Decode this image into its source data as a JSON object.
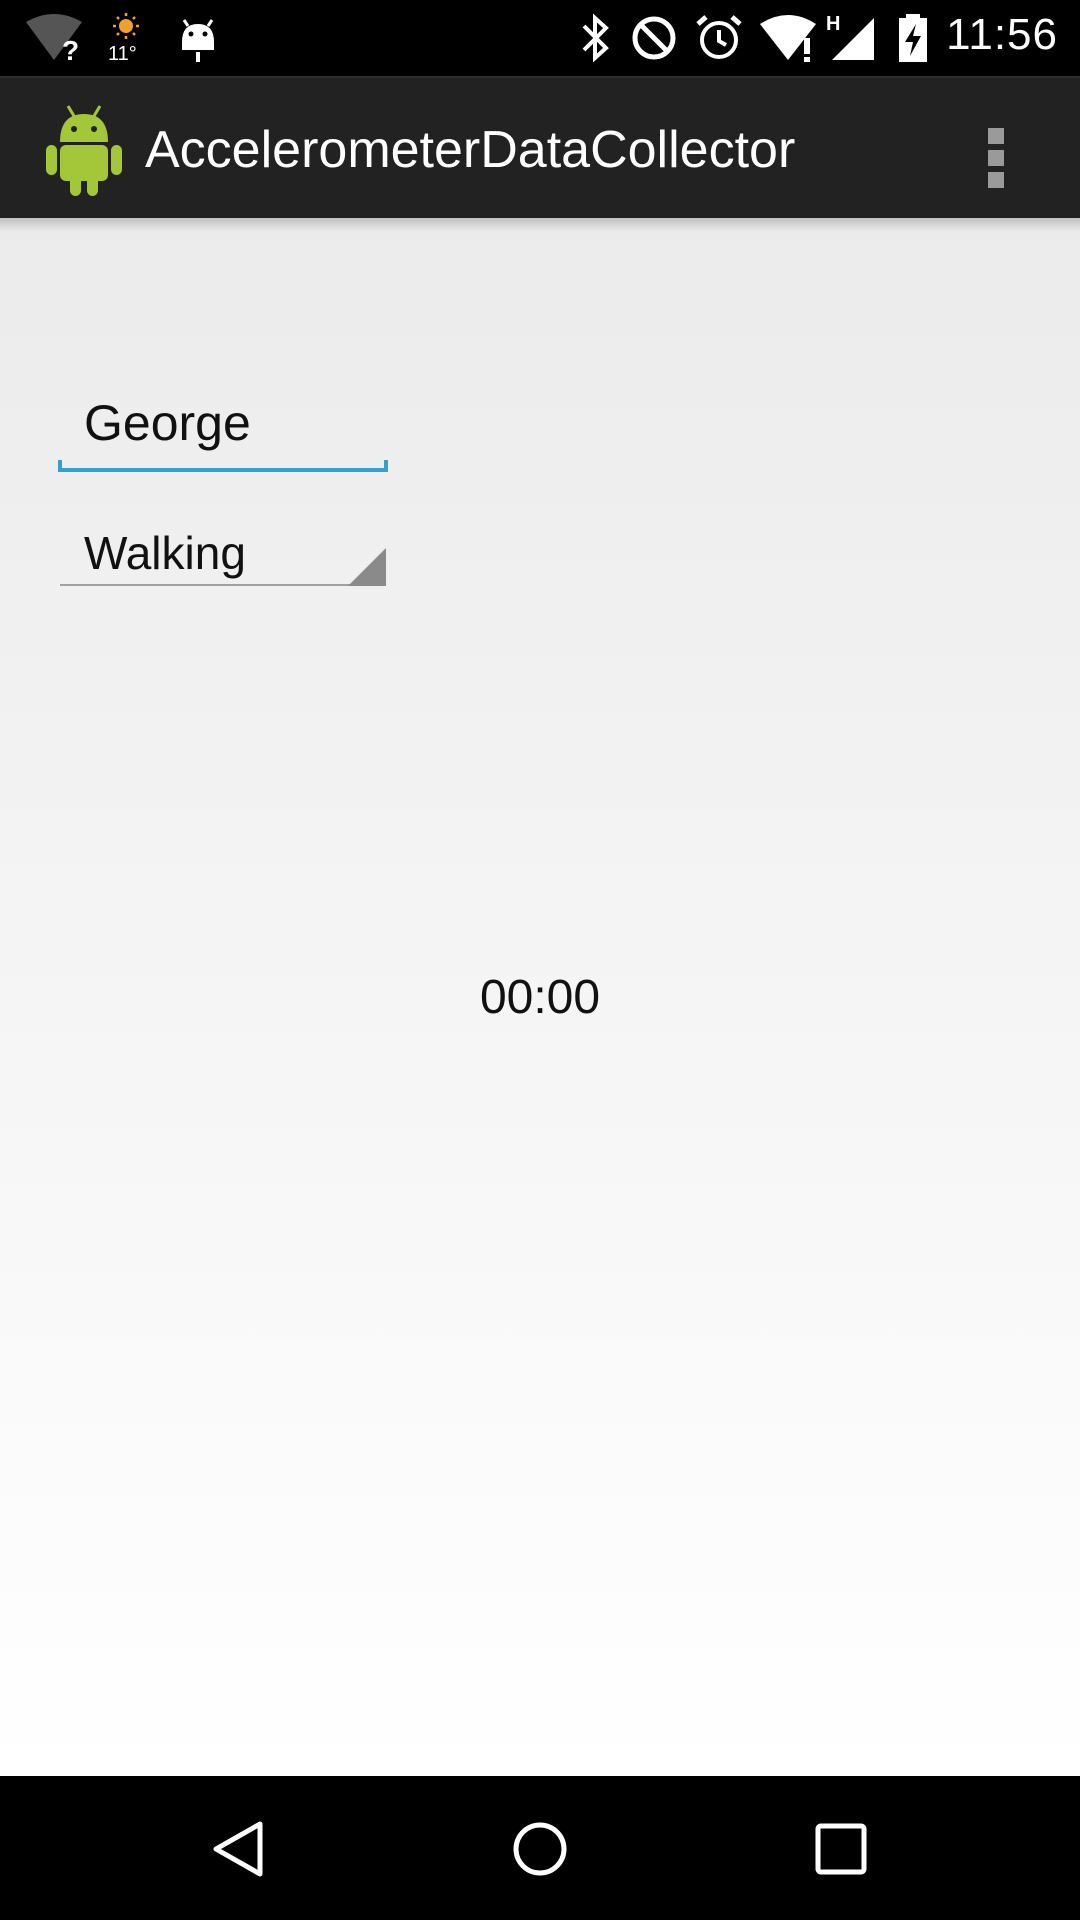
{
  "status_bar": {
    "time": "11:56",
    "temperature": "11°",
    "icons": [
      "wifi-unknown-icon",
      "weather-sun-icon",
      "android-debug-icon",
      "bluetooth-icon",
      "do-not-disturb-icon",
      "alarm-icon",
      "wifi-icon",
      "signal-h-icon",
      "battery-charging-icon"
    ]
  },
  "action_bar": {
    "title": "AccelerometerDataCollector",
    "icon": "android-app-icon",
    "overflow_icon": "overflow-menu-icon"
  },
  "form": {
    "name_value": "George",
    "activity_value": "Walking"
  },
  "timer": "00:00",
  "nav_bar": {
    "icons": [
      "back-icon",
      "home-icon",
      "recents-icon"
    ]
  },
  "colors": {
    "accent": "#33a0d0",
    "action_bar": "#222222",
    "android_green": "#a4c639"
  }
}
